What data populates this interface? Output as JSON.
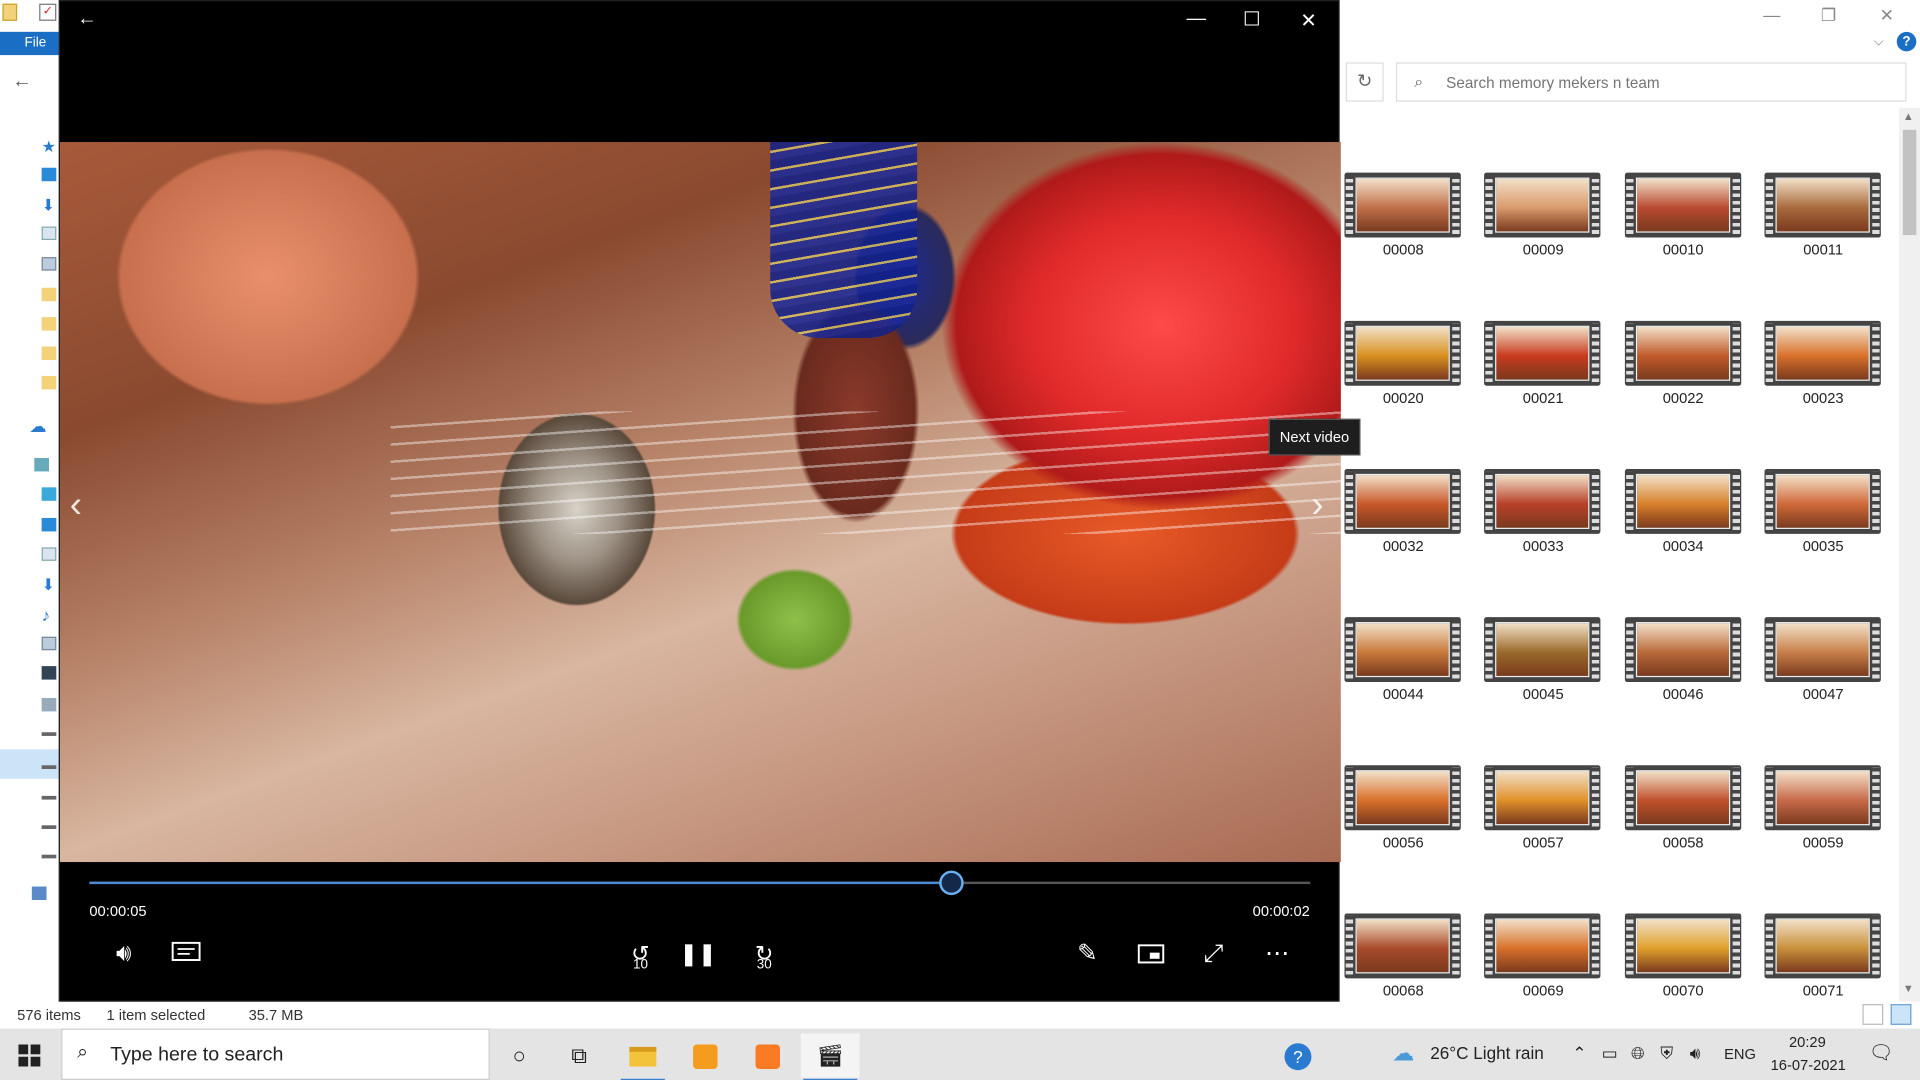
{
  "explorer": {
    "file_tab": "File",
    "search_placeholder": "Search memory mekers n team",
    "status": {
      "count": "576 items",
      "selected": "1 item selected",
      "size": "35.7 MB"
    },
    "thumbnails": [
      {
        "label": "00008",
        "color": "#c0704a"
      },
      {
        "label": "00009",
        "color": "#d99a6c"
      },
      {
        "label": "00010",
        "color": "#b84a30"
      },
      {
        "label": "00011",
        "color": "#a86a3c"
      },
      {
        "label": "00020",
        "color": "#d8901e"
      },
      {
        "label": "00021",
        "color": "#c83a1e"
      },
      {
        "label": "00022",
        "color": "#c05a2a"
      },
      {
        "label": "00023",
        "color": "#d8702a"
      },
      {
        "label": "00032",
        "color": "#c8582a"
      },
      {
        "label": "00033",
        "color": "#b8402a"
      },
      {
        "label": "00034",
        "color": "#d8802a"
      },
      {
        "label": "00035",
        "color": "#d06a3a"
      },
      {
        "label": "00044",
        "color": "#c87a3a"
      },
      {
        "label": "00045",
        "color": "#9a6a2a"
      },
      {
        "label": "00046",
        "color": "#b86a3a"
      },
      {
        "label": "00047",
        "color": "#c8804a"
      },
      {
        "label": "00056",
        "color": "#d8702a"
      },
      {
        "label": "00057",
        "color": "#e0902a"
      },
      {
        "label": "00058",
        "color": "#c0502a"
      },
      {
        "label": "00059",
        "color": "#c86a4a"
      },
      {
        "label": "00068",
        "color": "#a84a2a"
      },
      {
        "label": "00069",
        "color": "#d8702a"
      },
      {
        "label": "00070",
        "color": "#e0a02a"
      },
      {
        "label": "00071",
        "color": "#c8903a"
      }
    ]
  },
  "player": {
    "tooltip": "Next video",
    "elapsed": "00:00:05",
    "remaining": "00:00:02",
    "progress": 0.706,
    "skip_back_label": "10",
    "skip_forward_label": "30"
  },
  "taskbar": {
    "search_text": "Type here to search",
    "weather": "26°C  Light rain",
    "lang": "ENG",
    "time": "20:29",
    "date": "16-07-2021"
  },
  "colors": {
    "accent": "#4a8ad6",
    "explorer_blue": "#1a6ec4"
  }
}
